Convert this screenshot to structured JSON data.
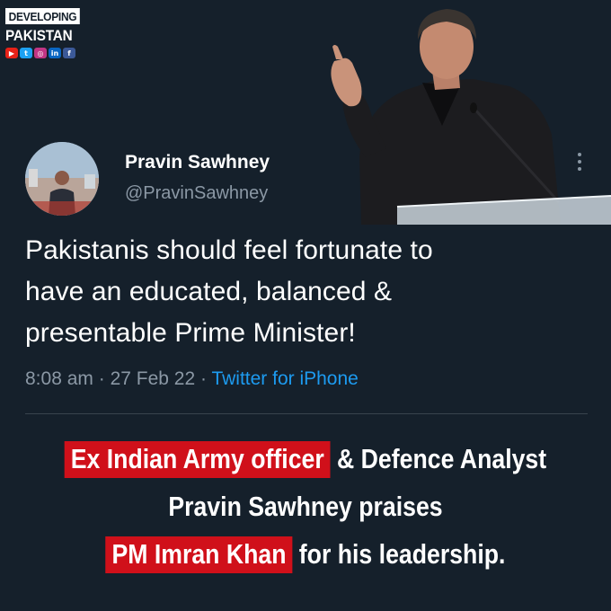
{
  "brand": {
    "top": "DEVELOPING",
    "bottom": "PAKISTAN",
    "social_icons": [
      "youtube-icon",
      "twitter-icon",
      "instagram-icon",
      "linkedin-icon",
      "facebook-icon"
    ]
  },
  "tweet": {
    "name": "Pravin Sawhney",
    "handle": "@PravinSawhney",
    "text_lines": [
      "Pakistanis should feel fortunate to",
      "have an educated, balanced &",
      "presentable Prime Minister!"
    ],
    "time": "8:08 am",
    "separator": " · ",
    "date": "27 Feb 22",
    "source": "Twitter for iPhone"
  },
  "headline": {
    "line1_highlight": "Ex Indian Army officer",
    "line1_rest": " & Defence Analyst",
    "line2": "Pravin Sawhney praises",
    "line3_highlight": "PM Imran Khan",
    "line3_rest": " for his leadership."
  },
  "colors": {
    "background": "#15202b",
    "highlight": "#d0101a",
    "link": "#1d9bf0",
    "muted": "#8b98a5"
  }
}
